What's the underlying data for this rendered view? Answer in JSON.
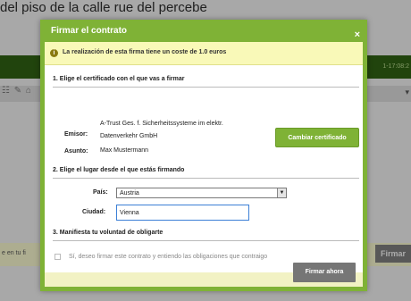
{
  "background": {
    "page_title": "del piso de la calle rue del percebe",
    "greenbar_text": "1-17:08:2",
    "toolbar_icons": "☷ ✎ ⌂",
    "bottom_text": "e en tu fi",
    "bottom_button": "Firmar"
  },
  "modal": {
    "title": "Firmar el contrato",
    "close_label": "×",
    "notice": "La realización de esta firma tiene un coste de 1.0 euros",
    "section1": {
      "title": "1. Elige el certificado con el que vas a firmar",
      "issuer_label": "Emisor:",
      "issuer_line1": "A-Trust Ges. f. Sicherheitssysteme im elektr.",
      "issuer_line2": "Datenverkehr GmbH",
      "subject_label": "Asunto:",
      "subject_value": "Max Mustermann",
      "change_button": "Cambiar certificado"
    },
    "section2": {
      "title": "2. Elige el lugar desde el que estás firmando",
      "country_label": "País:",
      "country_value": "Austria",
      "city_label": "Ciudad:",
      "city_value": "Vienna"
    },
    "section3": {
      "title": "3. Manifiesta tu voluntad de obligarte",
      "checkbox_label": "Sí, deseo firmar este contrato y entiendo las obligaciones que contraigo"
    },
    "sign_button": "Firmar ahora"
  },
  "colors": {
    "modal_green": "#7fb236",
    "notice_yellow": "#f9f9b8",
    "sign_button": "#767676"
  }
}
